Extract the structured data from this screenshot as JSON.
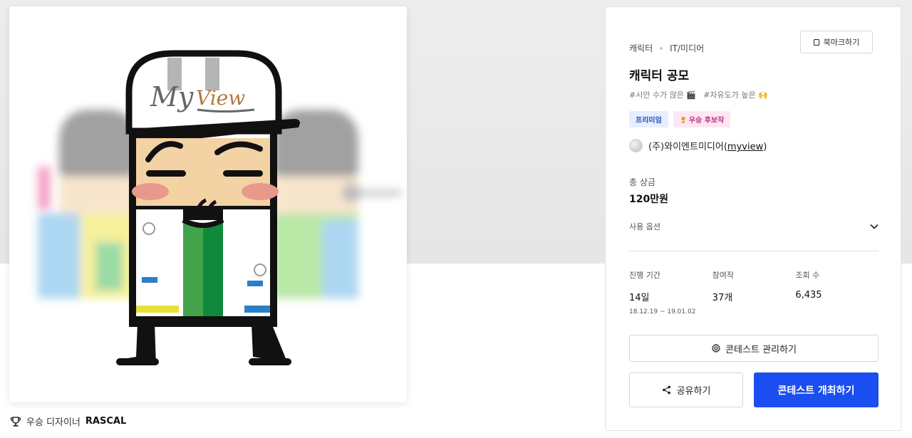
{
  "hero": {
    "logo_my": "My",
    "logo_view": "View"
  },
  "winner": {
    "label": "우승 디자이너",
    "name": "RASCAL"
  },
  "panel": {
    "category": "캐릭터",
    "field": "IT/미디어",
    "bookmark_label": "북마크하기",
    "title": "캐릭터 공모",
    "tags": [
      "#시안 수가 많은 🎬",
      "#자유도가 높은 🙌"
    ],
    "badge_premium": "프리미엄",
    "badge_winner": "우승 후보작",
    "host_name": "(주)와이엔트미디어",
    "host_open": "(",
    "host_id": "myview",
    "host_close": ")",
    "prize_label": "총 상금",
    "prize_value": "120만원",
    "usage_label": "사용 옵션",
    "stats": {
      "period_label": "진행 기간",
      "period_value": "14일",
      "period_dates": "18.12.19 ~ 19.01.02",
      "participants_label": "참여작",
      "participants_value": "37개",
      "views_label": "조회 수",
      "views_value": "6,435"
    },
    "manage_label": "콘테스트 관리하기",
    "share_label": "공유하기",
    "host_contest_label": "콘테스트 개최하기"
  },
  "colors": {
    "primary": "#1b4ef0",
    "premium_bg": "#e6efff",
    "premium_text": "#2a4fb0",
    "winner_bg": "#fde7f3",
    "winner_text": "#c2338a"
  }
}
